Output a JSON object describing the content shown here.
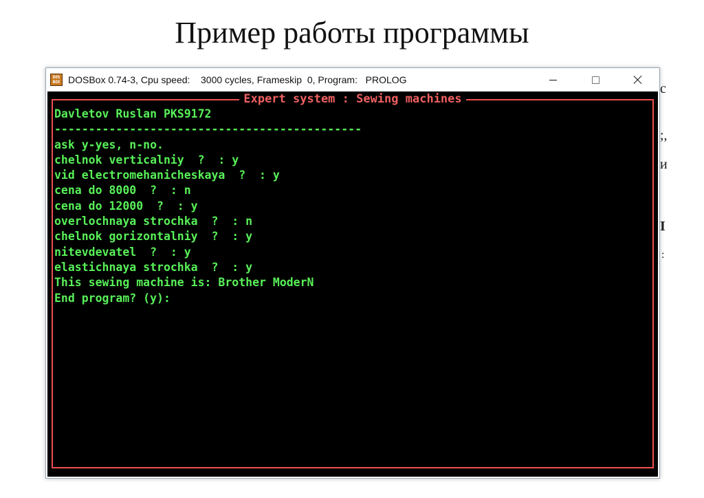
{
  "slide": {
    "title": "Пример работы программы",
    "peek": [
      "с",
      ";,",
      "и",
      "I",
      ":"
    ]
  },
  "window": {
    "icon_label_top": "DOS",
    "icon_label_bottom": "BOX",
    "icon": "dosbox-icon",
    "title": "DOSBox 0.74-3, Cpu speed:    3000 cycles, Frameskip  0, Program:   PROLOG",
    "controls": {
      "minimize": "minimize-icon",
      "maximize": "maximize-icon",
      "close": "close-icon"
    }
  },
  "screen": {
    "frame_title": "Expert system : Sewing machines",
    "colors": {
      "background": "#000000",
      "text": "#58f058",
      "frame": "#f05050"
    },
    "lines": [
      "Davletov Ruslan PKS9172",
      "---------------------------------------------",
      "ask y-yes, n-no.",
      "chelnok verticalniy  ?  : y",
      "vid electromehanicheskaya  ?  : y",
      "cena do 8000  ?  : n",
      "cena do 12000  ?  : y",
      "overlochnaya strochka  ?  : n",
      "chelnok gorizontalniy  ?  : y",
      "nitevdevatel  ?  : y",
      "elastichnaya strochka  ?  : y",
      "This sewing machine is: Brother ModerN",
      "End program? (y):"
    ]
  }
}
